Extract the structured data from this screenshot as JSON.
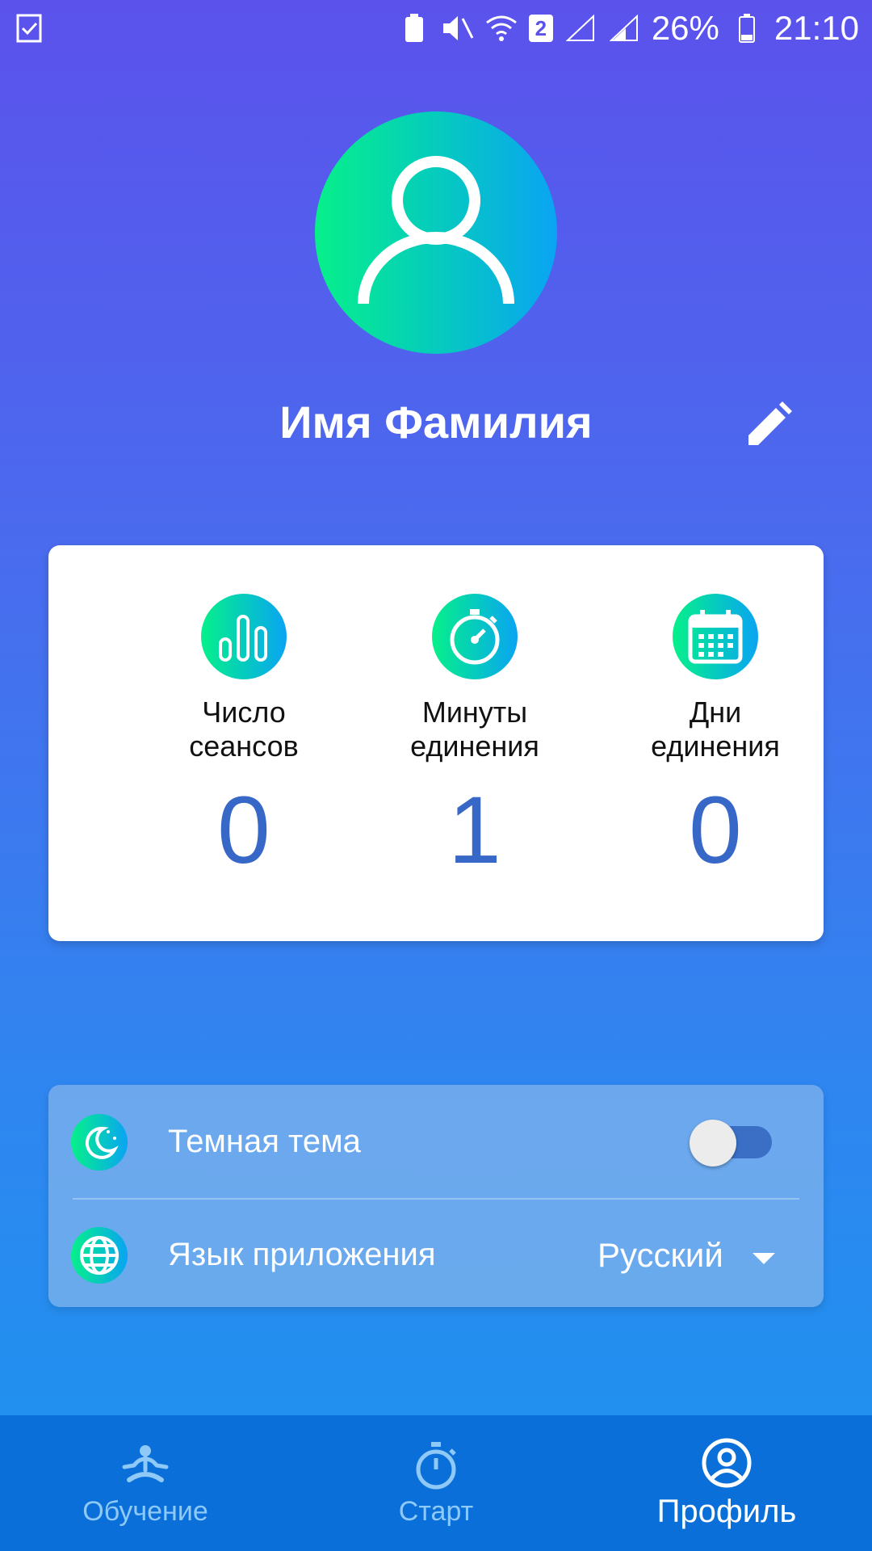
{
  "status_bar": {
    "sim_badge": "2",
    "battery_percent": "26%",
    "time": "21:10"
  },
  "profile": {
    "name": "Имя Фамилия",
    "avatar_icon": "person-outline-icon",
    "edit_icon": "pencil-icon"
  },
  "stats": [
    {
      "icon": "bar-chart-icon",
      "label_line1": "Число",
      "label_line2": "сеансов",
      "value": "0"
    },
    {
      "icon": "stopwatch-icon",
      "label_line1": "Минуты",
      "label_line2": "единения",
      "value": "1"
    },
    {
      "icon": "calendar-icon",
      "label_line1": "Дни",
      "label_line2": "единения",
      "value": "0"
    }
  ],
  "settings": {
    "dark_theme": {
      "icon": "moon-icon",
      "label": "Темная тема",
      "enabled": false
    },
    "language": {
      "icon": "globe-icon",
      "label": "Язык приложения",
      "value": "Русский"
    }
  },
  "bottom_nav": [
    {
      "icon": "meditation-icon",
      "label": "Обучение",
      "active": false
    },
    {
      "icon": "stopwatch-icon",
      "label": "Старт",
      "active": false
    },
    {
      "icon": "profile-icon",
      "label": "Профиль",
      "active": true
    }
  ],
  "colors": {
    "accent_gradient_start": "#07f08a",
    "accent_gradient_end": "#0aa4f3",
    "stat_value": "#3767c7",
    "nav_bg": "#0a6fd8"
  }
}
